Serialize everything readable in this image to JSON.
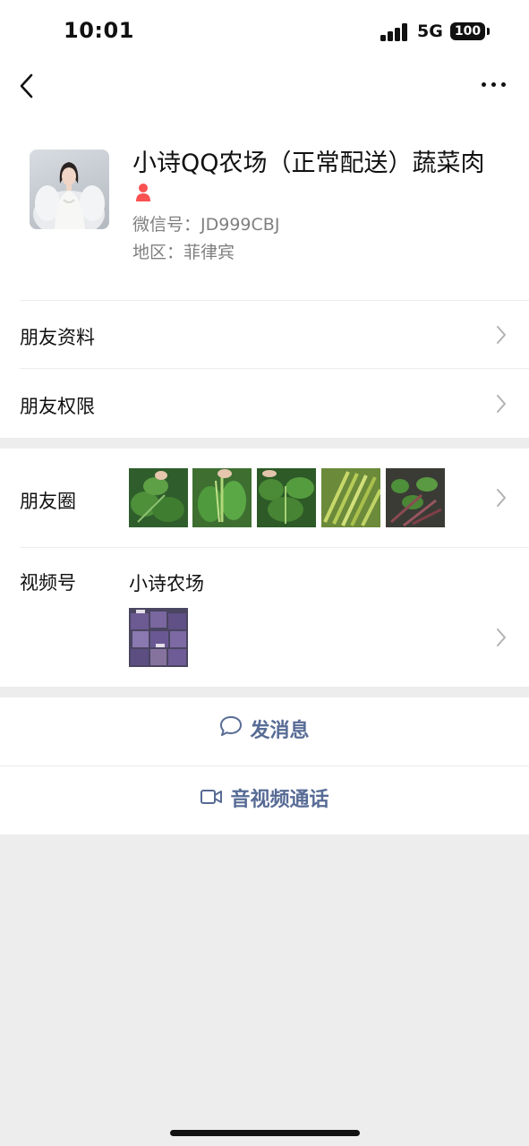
{
  "status_bar": {
    "time": "10:01",
    "network": "5G",
    "battery": "100"
  },
  "profile": {
    "name": "小诗QQ农场（正常配送）蔬菜肉",
    "wechat_id_label": "微信号：",
    "wechat_id": "JD999CBJ",
    "region_label": "地区：",
    "region": "菲律宾",
    "gender_icon": "female-icon",
    "gender_color": "#fa5151"
  },
  "menu": {
    "friend_profile": "朋友资料",
    "friend_permissions": "朋友权限",
    "moments": "朋友圈",
    "channels": "视频号",
    "channels_name": "小诗农场"
  },
  "actions": {
    "send_message": "发消息",
    "video_call": "音视频通话"
  },
  "colors": {
    "link": "#576b95",
    "background": "#ededed",
    "card": "#ffffff"
  }
}
